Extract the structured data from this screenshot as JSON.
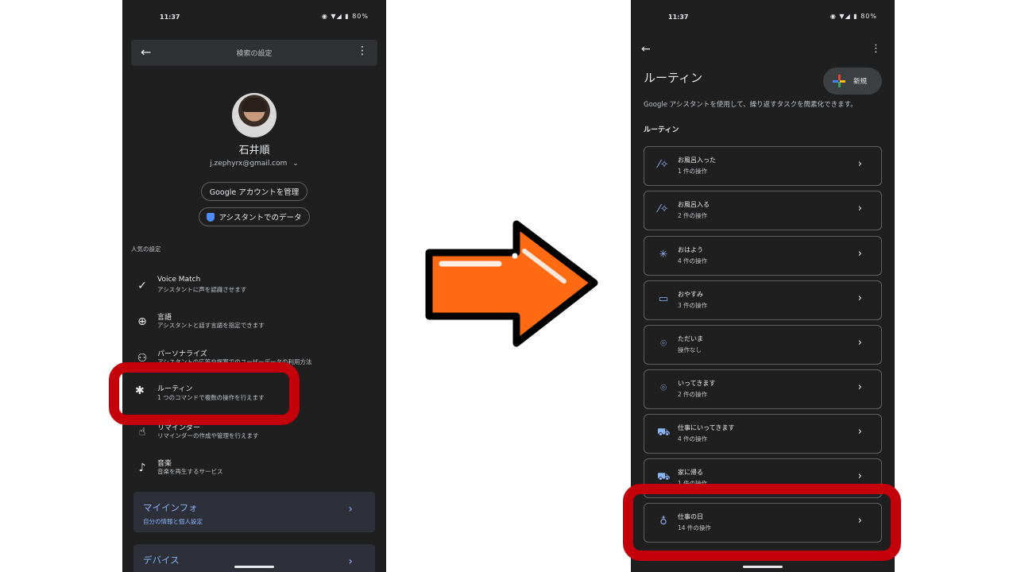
{
  "left": {
    "status": {
      "time": "11:37",
      "battery": "80%"
    },
    "header": {
      "title": "検索の設定"
    },
    "account": {
      "name": "石井順",
      "email": "j.zephyrx@gmail.com",
      "manage_label": "Google アカウントを管理",
      "data_label": "アシスタントでのデータ"
    },
    "section_label": "人気の設定",
    "items": [
      {
        "title": "Voice Match",
        "subtitle": "アシスタントに声を認識させます",
        "icon": "voice-match-icon"
      },
      {
        "title": "言語",
        "subtitle": "アシスタントと話す言語を指定できます",
        "icon": "globe-icon"
      },
      {
        "title": "パーソナライズ",
        "subtitle": "アシスタントの応答や提案でのユーザーデータの利用方法",
        "icon": "person-check-icon"
      },
      {
        "title": "ルーティン",
        "subtitle": "1 つのコマンドで複数の操作を行えます",
        "icon": "routine-icon"
      },
      {
        "title": "リマインダー",
        "subtitle": "リマインダーの作成や管理を行えます",
        "icon": "hand-icon"
      },
      {
        "title": "音楽",
        "subtitle": "音楽を再生するサービス",
        "icon": "music-note-icon"
      }
    ],
    "cards": [
      {
        "title": "マイインフォ",
        "subtitle": "自分の情報と個人設定"
      },
      {
        "title": "デバイス",
        "subtitle": ""
      }
    ]
  },
  "right": {
    "status": {
      "time": "11:37",
      "battery": "80%"
    },
    "title": "ルーティン",
    "new_label": "新規",
    "description": "Google アシスタントを使用して、繰り返すタスクを簡素化できます。",
    "section": "ルーティン",
    "routines": [
      {
        "name": "お風呂入った",
        "actions": "1 件の操作",
        "icon": "magic-wand-icon"
      },
      {
        "name": "お風呂入る",
        "actions": "2 件の操作",
        "icon": "magic-wand-icon"
      },
      {
        "name": "おはよう",
        "actions": "4 件の操作",
        "icon": "sun-icon"
      },
      {
        "name": "おやすみ",
        "actions": "3 件の操作",
        "icon": "bed-icon"
      },
      {
        "name": "ただいま",
        "actions": "操作なし",
        "icon": "location-pin-icon"
      },
      {
        "name": "いってきます",
        "actions": "2 件の操作",
        "icon": "location-pin-icon"
      },
      {
        "name": "仕事にいってきます",
        "actions": "4 件の操作",
        "icon": "commute-icon"
      },
      {
        "name": "家に帰る",
        "actions": "1 件の操作",
        "icon": "commute-icon"
      },
      {
        "name": "仕事の日",
        "actions": "14 件の操作",
        "icon": "workday-icon"
      }
    ]
  },
  "colors": {
    "highlight": "#c4000b",
    "arrow": "#ff6a13",
    "accent": "#8ab4f8"
  }
}
